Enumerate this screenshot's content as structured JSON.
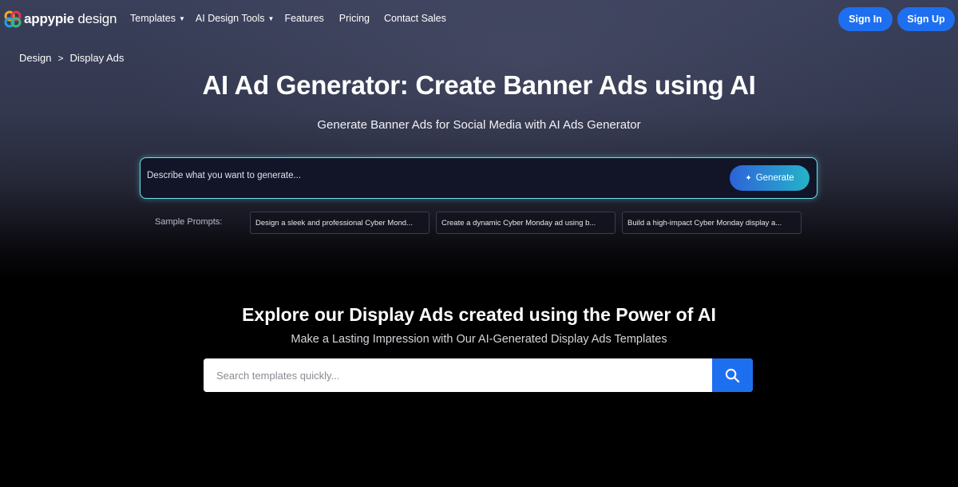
{
  "brand": {
    "name_bold": "appypie",
    "name_light": " design",
    "accent": "#1e6ff0"
  },
  "nav": {
    "items": [
      {
        "label": "Templates",
        "dropdown": true
      },
      {
        "label": "AI Design Tools",
        "dropdown": true
      },
      {
        "label": "Features",
        "dropdown": false
      },
      {
        "label": "Pricing",
        "dropdown": false
      },
      {
        "label": "Contact Sales",
        "dropdown": false
      }
    ],
    "sign_in": "Sign In",
    "sign_up": "Sign Up"
  },
  "breadcrumb": {
    "root": "Design",
    "separator": ">",
    "current": "Display Ads"
  },
  "hero": {
    "title": "AI Ad Generator: Create Banner Ads using AI",
    "subtitle": "Generate Banner Ads for Social Media with AI Ads Generator",
    "prompt_placeholder": "Describe what you want to generate...",
    "generate_label": "Generate",
    "samples_label": "Sample Prompts:",
    "samples": [
      "Design a sleek and professional Cyber Mond...",
      "Create a dynamic Cyber Monday ad using b...",
      "Build a high-impact Cyber Monday display a..."
    ]
  },
  "explore": {
    "title": "Explore our Display Ads created using the Power of AI",
    "subtitle": "Make a Lasting Impression with Our AI-Generated Display Ads Templates",
    "search_placeholder": "Search templates quickly..."
  },
  "icons": {
    "logo": "appypie-logo-icon",
    "caret": "caret-down-icon",
    "sparkle": "sparkle-icon",
    "search": "search-icon"
  }
}
